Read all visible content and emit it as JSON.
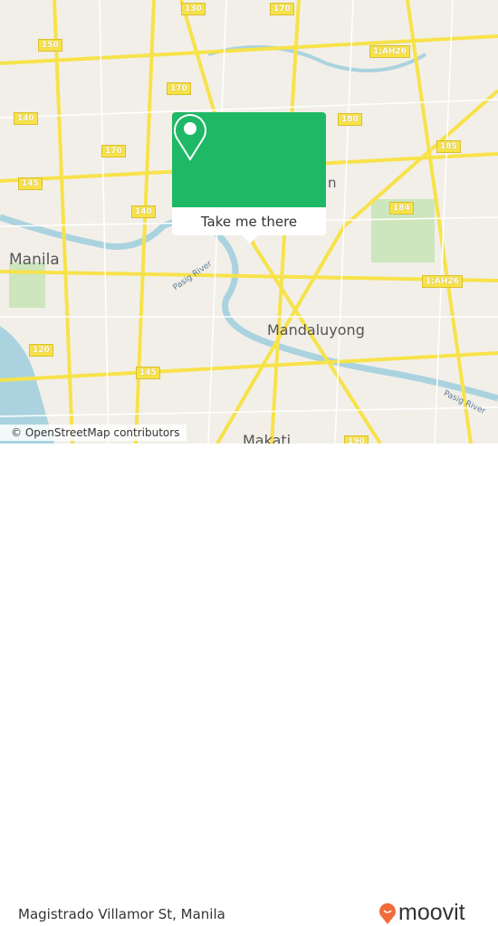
{
  "map": {
    "cities": [
      "Manila",
      "Mandaluyong",
      "Makati",
      "n"
    ],
    "rivers": [
      "Pasig River",
      "Pasig River"
    ],
    "shields": [
      "130",
      "170",
      "150",
      "170",
      "140",
      "170",
      "145",
      "140",
      "180",
      "185",
      "184",
      "1;AH26",
      "1;AH26",
      "120",
      "145",
      "190"
    ],
    "attribution": "© OpenStreetMap contributors",
    "colors": {
      "land": "#f2efe9",
      "water": "#aad3df",
      "road": "#f7e24a",
      "accent": "#1fb866"
    }
  },
  "popup": {
    "icon": "map-pin-icon",
    "button_label": "Take me there"
  },
  "footer": {
    "place": "Magistrado Villamor St, Manila",
    "brand": "moovit",
    "brand_color": "#f26b3a"
  }
}
